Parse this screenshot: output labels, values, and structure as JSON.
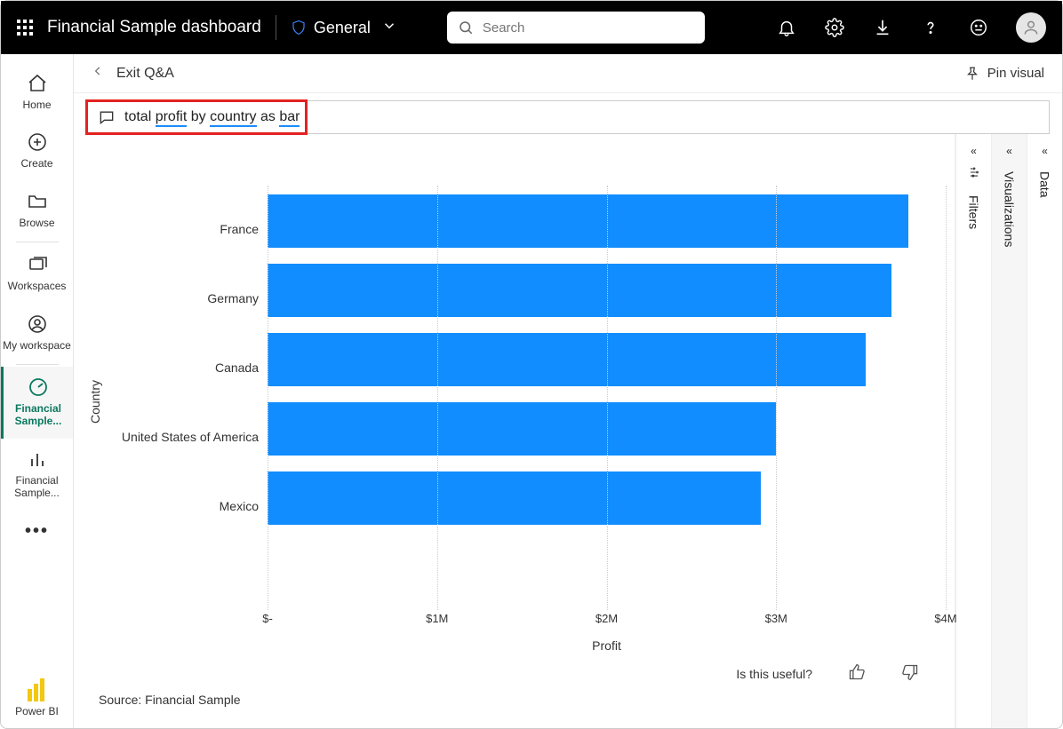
{
  "header": {
    "title": "Financial Sample dashboard",
    "classification": "General",
    "search_placeholder": "Search"
  },
  "leftnav": {
    "home": "Home",
    "create": "Create",
    "browse": "Browse",
    "workspaces": "Workspaces",
    "my_workspace": "My workspace",
    "fin1": "Financial Sample...",
    "fin2": "Financial Sample...",
    "powerbi": "Power BI"
  },
  "crumb": {
    "exit": "Exit Q&A",
    "pin": "Pin visual"
  },
  "qna": {
    "pre": "total ",
    "u1": "profit",
    "mid1": " by ",
    "u2": "country",
    "mid2": " as ",
    "u3": "bar"
  },
  "panes": {
    "filters": "Filters",
    "viz": "Visualizations",
    "data": "Data"
  },
  "feedback": {
    "prompt": "Is this useful?"
  },
  "source": "Source: Financial Sample",
  "chart_data": {
    "type": "bar",
    "orientation": "horizontal",
    "ylabel": "Country",
    "xlabel": "Profit",
    "xticks": [
      "$-",
      "$1M",
      "$2M",
      "$3M",
      "$4M"
    ],
    "xlim": [
      0,
      4000000
    ],
    "categories": [
      "France",
      "Germany",
      "Canada",
      "United States of America",
      "Mexico"
    ],
    "values": [
      3780000,
      3680000,
      3530000,
      3000000,
      2910000
    ],
    "color": "#118dff"
  }
}
